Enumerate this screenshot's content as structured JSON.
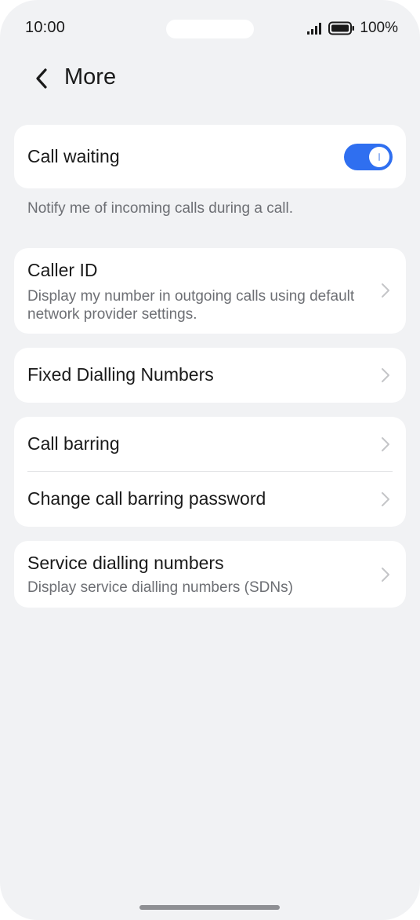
{
  "status_bar": {
    "time": "10:00",
    "battery": "100%",
    "signal_icon": "signal-bars-icon",
    "battery_icon": "battery-icon"
  },
  "header": {
    "back_icon": "chevron-left-icon",
    "title": "More"
  },
  "call_waiting": {
    "label": "Call waiting",
    "enabled": true,
    "note": "Notify me of incoming calls during a call."
  },
  "caller_id": {
    "title": "Caller ID",
    "subtitle": "Display my number in outgoing calls using default network provider settings."
  },
  "fixed_dialling": {
    "title": "Fixed Dialling Numbers"
  },
  "call_barring": {
    "title": "Call barring",
    "password_title": "Change call barring password"
  },
  "service_dialling": {
    "title": "Service dialling numbers",
    "subtitle": "Display service dialling numbers (SDNs)"
  },
  "colors": {
    "background": "#f1f2f4",
    "card": "#ffffff",
    "accent": "#2f6ff0",
    "secondary_text": "#6d6f74"
  }
}
